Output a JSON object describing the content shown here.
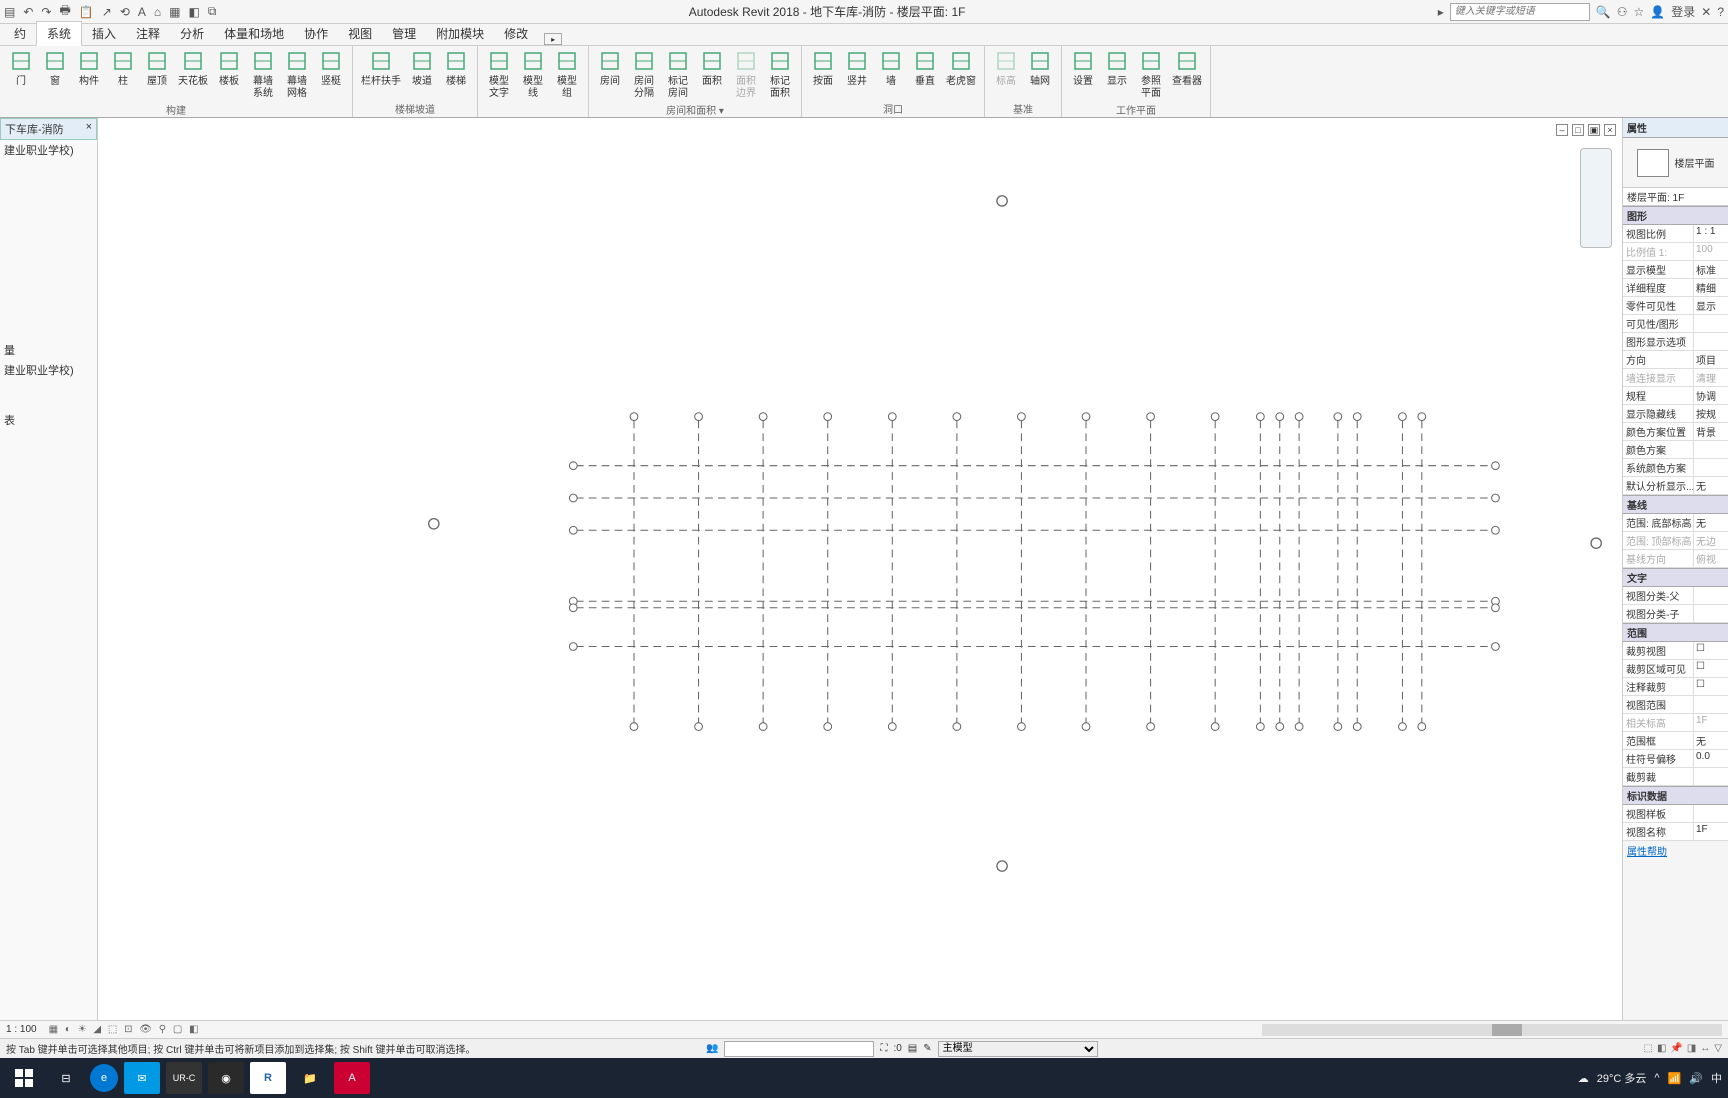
{
  "titlebar": {
    "title": "Autodesk Revit 2018 -     地下车库-消防 - 楼层平面: 1F",
    "search_ph": "键入关键字或短语",
    "login": "登录"
  },
  "tabs": [
    "约",
    "系统",
    "插入",
    "注释",
    "分析",
    "体量和场地",
    "协作",
    "视图",
    "管理",
    "附加模块",
    "修改"
  ],
  "active_tab": 1,
  "ribbon": {
    "g1_label": "构建",
    "g2_label": "楼梯坡道",
    "g4_label": "房间和面积 ▾",
    "g5_label": "洞口",
    "g6_label": "基准",
    "g7_label": "工作平面",
    "items1": [
      "门",
      "窗",
      "构件",
      "柱",
      "屋顶",
      "天花板",
      "楼板",
      "幕墙 系统",
      "幕墙 网格",
      "竖梃"
    ],
    "items2": [
      "栏杆扶手",
      "坡道",
      "楼梯"
    ],
    "items3": [
      "模型 文字",
      "模型 线",
      "模型 组"
    ],
    "items4": [
      "房间",
      "房间 分隔",
      "标记 房间",
      "面积",
      "面积 边界",
      "标记 面积"
    ],
    "items5": [
      "按面",
      "竖井",
      "墙",
      "垂直",
      "老虎窗"
    ],
    "items6": [
      "标高",
      "轴网"
    ],
    "items7": [
      "设置",
      "显示",
      "参照 平面",
      "查看器"
    ]
  },
  "left": {
    "hdr": "下车库-消防",
    "n1": "建业职业学校)",
    "n2": "量",
    "n3": "建业职业学校)",
    "n4": "表"
  },
  "props": {
    "title": "属性",
    "type": "楼层平面",
    "sub": "楼层平面: 1F",
    "sections": {
      "graphics": "图形",
      "baseline": "基线",
      "text": "文字",
      "extent": "范围",
      "iddata": "标识数据"
    },
    "rows": [
      {
        "k": "视图比例",
        "v": "1 : 1"
      },
      {
        "k": "比例值 1:",
        "v": "100",
        "dis": true
      },
      {
        "k": "显示模型",
        "v": "标准"
      },
      {
        "k": "详细程度",
        "v": "精细"
      },
      {
        "k": "零件可见性",
        "v": "显示"
      },
      {
        "k": "可见性/图形",
        "v": ""
      },
      {
        "k": "图形显示选项",
        "v": ""
      },
      {
        "k": "方向",
        "v": "项目"
      },
      {
        "k": "墙连接显示",
        "v": "清理",
        "dis": true
      },
      {
        "k": "规程",
        "v": "协调"
      },
      {
        "k": "显示隐藏线",
        "v": "按规"
      },
      {
        "k": "颜色方案位置",
        "v": "背景"
      },
      {
        "k": "颜色方案",
        "v": ""
      },
      {
        "k": "系统颜色方案",
        "v": ""
      },
      {
        "k": "默认分析显示...",
        "v": "无"
      }
    ],
    "baseline_rows": [
      {
        "k": "范围: 底部标高",
        "v": "无"
      },
      {
        "k": "范围: 顶部标高",
        "v": "无边",
        "dis": true
      },
      {
        "k": "基线方向",
        "v": "俯视",
        "dis": true
      }
    ],
    "text_rows": [
      {
        "k": "视图分类-父",
        "v": ""
      },
      {
        "k": "视图分类-子",
        "v": ""
      }
    ],
    "extent_rows": [
      {
        "k": "裁剪视图",
        "v": "☐"
      },
      {
        "k": "裁剪区域可见",
        "v": "☐"
      },
      {
        "k": "注释裁剪",
        "v": "☐"
      },
      {
        "k": "视图范围",
        "v": ""
      },
      {
        "k": "相关标高",
        "v": "1F",
        "dis": true
      },
      {
        "k": "范围框",
        "v": "无"
      },
      {
        "k": "柱符号偏移",
        "v": "0.0"
      },
      {
        "k": "截剪裁",
        "v": ""
      }
    ],
    "id_rows": [
      {
        "k": "视图样板",
        "v": ""
      },
      {
        "k": "视图名称",
        "v": "1F"
      }
    ],
    "help": "属性帮助"
  },
  "vstatus": {
    "scale": "1 : 100"
  },
  "botbar": {
    "hint": "按 Tab 键并单击可选择其他项目; 按 Ctrl 键并单击可将新项目添加到选择集; 按 Shift 键并单击可取消选择。",
    "sel": ":0",
    "model": "主模型"
  },
  "taskbar": {
    "weather": "29°C 多云",
    "ime": "中"
  }
}
